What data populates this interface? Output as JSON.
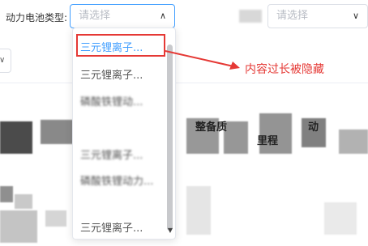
{
  "filter": {
    "label": "动力电池类型:",
    "select1": {
      "placeholder": "请选择"
    },
    "select2": {
      "placeholder": "请选择"
    }
  },
  "table": {
    "headers": [
      "整备质",
      "里程"
    ]
  },
  "dropdown": {
    "options": [
      "三元锂离子...",
      "三元锂离子...",
      "磷酸铁锂动...",
      "",
      "三元锂离子...",
      "磷酸铁锂动力...",
      "",
      "三元锂离子..."
    ],
    "selected_index": 0
  },
  "annotation": {
    "text": "内容过长被隐藏"
  },
  "colors": {
    "accent": "#409eff",
    "annotation": "#e53935"
  }
}
